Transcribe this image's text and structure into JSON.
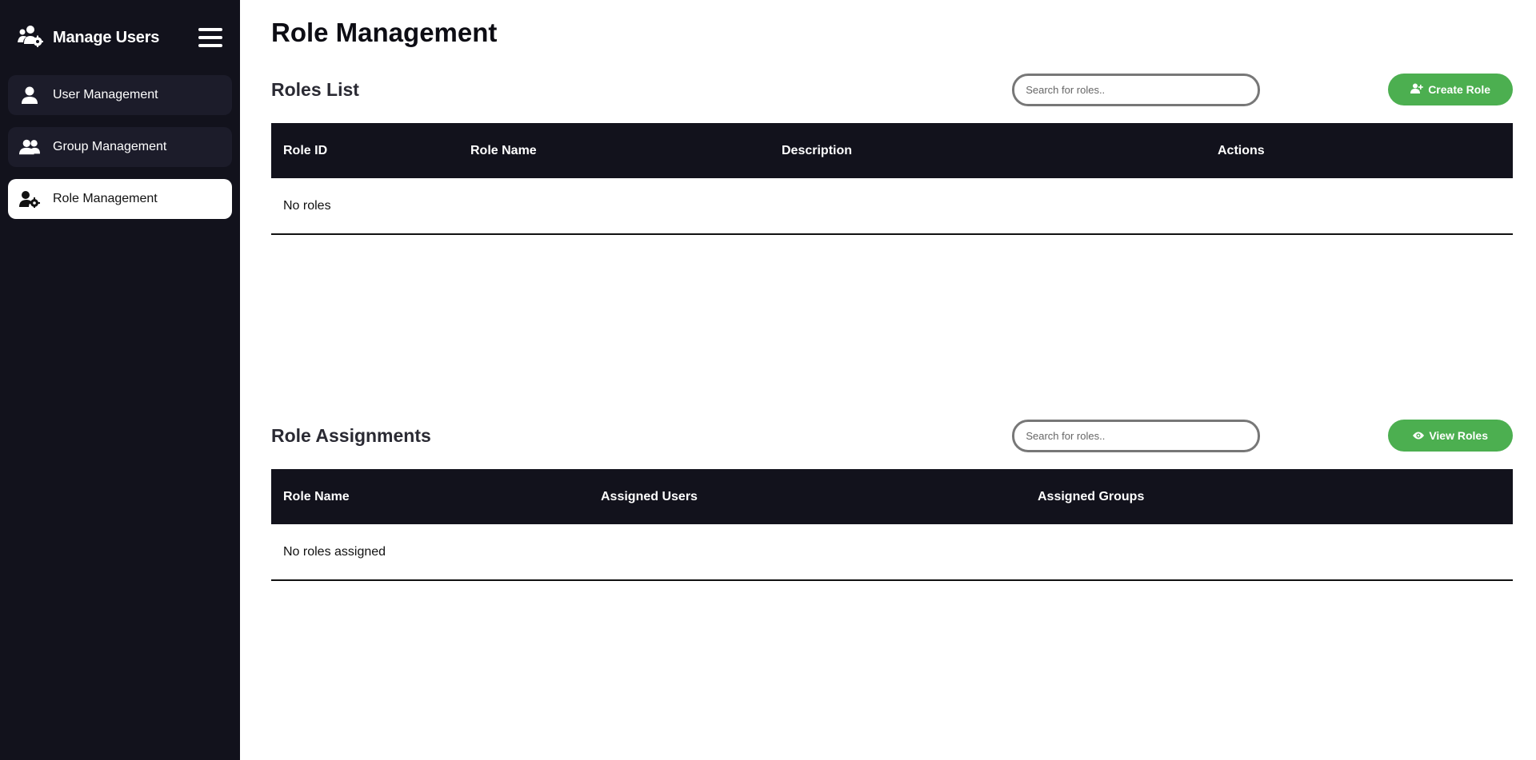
{
  "sidebar": {
    "brand_title": "Manage Users",
    "brand_icon": "users-cog-icon",
    "menu_icon": "hamburger-icon",
    "items": [
      {
        "label": "User Management",
        "icon": "user-icon",
        "active": false
      },
      {
        "label": "Group Management",
        "icon": "users-icon",
        "active": false
      },
      {
        "label": "Role Management",
        "icon": "user-cog-icon",
        "active": true
      }
    ]
  },
  "main": {
    "page_title": "Role Management",
    "roles_list": {
      "title": "Roles List",
      "search_placeholder": "Search for roles..",
      "button_label": "Create Role",
      "button_icon": "user-plus-icon",
      "columns": [
        "Role ID",
        "Role Name",
        "Description",
        "Actions"
      ],
      "empty_text": "No roles"
    },
    "role_assignments": {
      "title": "Role Assignments",
      "search_placeholder": "Search for roles..",
      "button_label": "View Roles",
      "button_icon": "eye-icon",
      "columns": [
        "Role Name",
        "Assigned Users",
        "Assigned Groups"
      ],
      "empty_text": "No roles assigned"
    }
  },
  "colors": {
    "sidebar_bg": "#12121c",
    "nav_item_bg": "#1c1c2a",
    "accent_green": "#4caf50",
    "table_header_bg": "#12121c"
  }
}
